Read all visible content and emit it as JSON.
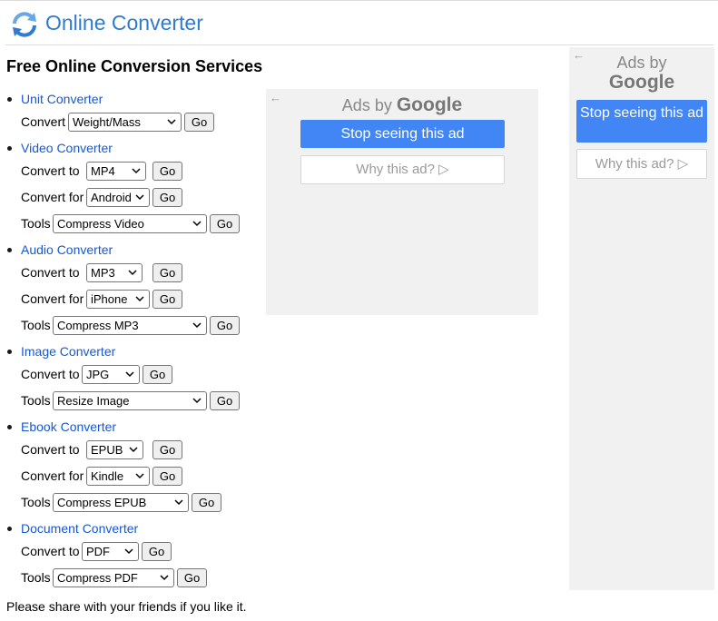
{
  "header": {
    "site_name": "Online Converter"
  },
  "page": {
    "title": "Free Online Conversion Services"
  },
  "categories": [
    {
      "name": "Unit Converter",
      "rows": [
        {
          "label": "Convert",
          "value": "Weight/Mass",
          "go": "Go"
        }
      ]
    },
    {
      "name": "Video Converter",
      "rows": [
        {
          "label": "Convert to",
          "value": "MP4",
          "go": "Go"
        },
        {
          "label": "Convert for",
          "value": "Android",
          "go": "Go"
        },
        {
          "label": "Tools",
          "value": "Compress Video",
          "go": "Go"
        }
      ]
    },
    {
      "name": "Audio Converter",
      "rows": [
        {
          "label": "Convert to",
          "value": "MP3",
          "go": "Go"
        },
        {
          "label": "Convert for",
          "value": "iPhone",
          "go": "Go"
        },
        {
          "label": "Tools",
          "value": "Compress MP3",
          "go": "Go"
        }
      ]
    },
    {
      "name": "Image Converter",
      "rows": [
        {
          "label": "Convert to",
          "value": "JPG",
          "go": "Go"
        },
        {
          "label": "Tools",
          "value": "Resize Image",
          "go": "Go"
        }
      ]
    },
    {
      "name": "Ebook Converter",
      "rows": [
        {
          "label": "Convert to",
          "value": "EPUB",
          "go": "Go"
        },
        {
          "label": "Convert for",
          "value": "Kindle",
          "go": "Go"
        },
        {
          "label": "Tools",
          "value": "Compress EPUB",
          "go": "Go"
        }
      ]
    },
    {
      "name": "Document Converter",
      "rows": [
        {
          "label": "Convert to",
          "value": "PDF",
          "go": "Go"
        },
        {
          "label": "Tools",
          "value": "Compress PDF",
          "go": "Go"
        }
      ]
    }
  ],
  "ads": {
    "ads_by": "Ads by",
    "google": "Google",
    "stop": "Stop seeing this ad",
    "why": "Why this ad? ▷",
    "back": "←"
  },
  "footer": {
    "text": "Please share with your friends if you like it."
  },
  "colors": {
    "link": "#1558d6",
    "brand": "#2e7bcf",
    "ad_button": "#4285f4"
  }
}
